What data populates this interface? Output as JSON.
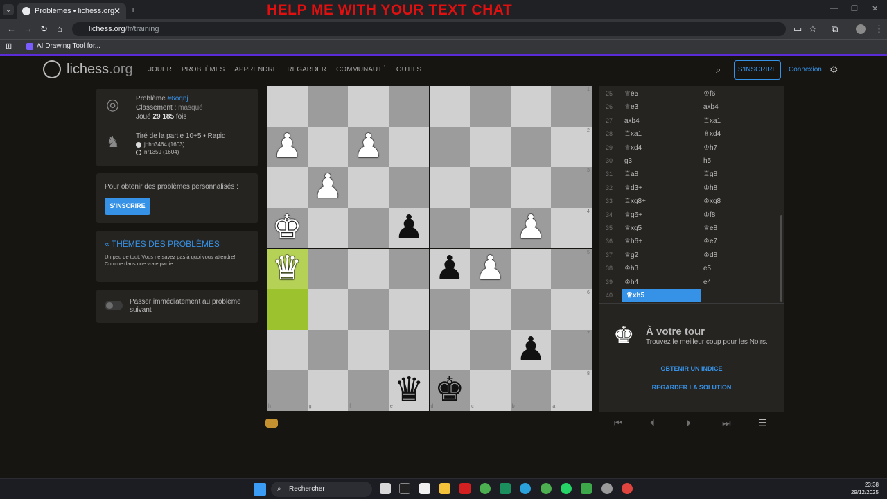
{
  "browser": {
    "tab_title": "Problèmes • lichess.org",
    "new_tab": "+",
    "overlay_text": "HELP ME WITH YOUR TEXT CHAT",
    "url_host": "lichess.org",
    "url_path": "/fr/training",
    "bookmark": "AI Drawing Tool for..."
  },
  "header": {
    "logo_main": "lichess",
    "logo_suffix": ".org",
    "nav": [
      "JOUER",
      "PROBLÈMES",
      "APPRENDRE",
      "REGARDER",
      "COMMUNAUTÉ",
      "OUTILS"
    ],
    "signup": "S'INSCRIRE",
    "login": "Connexion"
  },
  "puzzle_info": {
    "label_problem": "Problème ",
    "problem_id": "#6oqnj",
    "label_rating": "Classement : ",
    "rating": "masqué",
    "label_played": "Joué ",
    "played_count": "29 185",
    "played_suffix": " fois",
    "game_source": "Tiré de la partie 10+5 • Rapid",
    "white_player": "john3464 (1603)",
    "black_player": "nr1359 (1604)"
  },
  "personal": {
    "text": "Pour obtenir des problèmes personnalisés :",
    "button": "S'INSCRIRE"
  },
  "themes": {
    "title": "« THÈMES DES PROBLÈMES",
    "desc": "Un peu de tout. Vous ne savez pas à quoi vous attendre! Comme dans une vraie partie."
  },
  "toggle": {
    "label": "Passer immédiatement au problème suivant"
  },
  "board": {
    "rank_labels": [
      "1",
      "2",
      "3",
      "4",
      "5",
      "6",
      "7",
      "8"
    ],
    "file_labels": [
      "h",
      "g",
      "f",
      "e",
      "d",
      "c",
      "b",
      "a"
    ]
  },
  "moves": [
    {
      "n": "25",
      "w": "♕e5",
      "b": "♔f6"
    },
    {
      "n": "26",
      "w": "♕e3",
      "b": "axb4"
    },
    {
      "n": "27",
      "w": "axb4",
      "b": "♖xa1"
    },
    {
      "n": "28",
      "w": "♖xa1",
      "b": "♗xd4"
    },
    {
      "n": "29",
      "w": "♕xd4",
      "b": "♔h7"
    },
    {
      "n": "30",
      "w": "g3",
      "b": "h5"
    },
    {
      "n": "31",
      "w": "♖a8",
      "b": "♖g8"
    },
    {
      "n": "32",
      "w": "♕d3+",
      "b": "♔h8"
    },
    {
      "n": "33",
      "w": "♖xg8+",
      "b": "♔xg8"
    },
    {
      "n": "34",
      "w": "♕g6+",
      "b": "♔f8"
    },
    {
      "n": "35",
      "w": "♕xg5",
      "b": "♕e8"
    },
    {
      "n": "36",
      "w": "♕h6+",
      "b": "♔e7"
    },
    {
      "n": "37",
      "w": "♕g2",
      "b": "♔d8"
    },
    {
      "n": "38",
      "w": "♔h3",
      "b": "e5"
    },
    {
      "n": "39",
      "w": "♔h4",
      "b": "e4"
    },
    {
      "n": "40",
      "w": "♕xh5",
      "b": ""
    }
  ],
  "turn": {
    "title": "À votre tour",
    "subtitle": "Trouvez le meilleur coup pour les Noirs.",
    "hint": "OBTENIR UN INDICE",
    "solution": "REGARDER LA SOLUTION"
  },
  "taskbar": {
    "search": "Rechercher",
    "time": "23:38",
    "date": "29/12/2025"
  },
  "colors": {
    "accent": "#3692e7",
    "background": "#161512",
    "highlight": "#9cc22e",
    "overlay": "#e01010"
  }
}
